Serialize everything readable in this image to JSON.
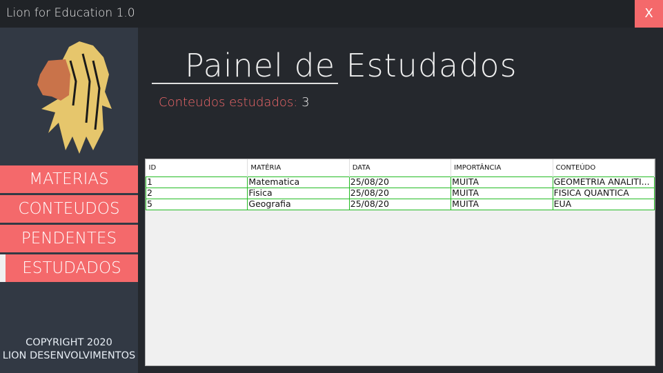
{
  "window": {
    "title": "Lion for Education 1.0",
    "close_label": "X"
  },
  "sidebar": {
    "items": [
      {
        "label": "MATERIAS"
      },
      {
        "label": "CONTEUDOS"
      },
      {
        "label": "PENDENTES"
      },
      {
        "label": "ESTUDADOS",
        "active": true
      }
    ],
    "copyright": [
      "COPYRIGHT 2020",
      "LION DESENVOLVIMENTOS"
    ]
  },
  "colors": {
    "accent": "#f4696b",
    "sidebar": "#323944",
    "background": "#25282d",
    "logo_mane": "#e6c66c",
    "logo_face": "#c9734a"
  },
  "main": {
    "title": "Painel de Estudados",
    "count_label": "Conteudos estudados:",
    "count_value": "3"
  },
  "table": {
    "columns": [
      "ID",
      "MATÉRIA",
      "DATA",
      "IMPORTÂNCIA",
      "CONTEÚDO"
    ],
    "rows": [
      [
        "1",
        "Matematica",
        "25/08/20",
        "MUITA",
        "GEOMETRIA ANALITI..."
      ],
      [
        "2",
        "Fisica",
        "25/08/20",
        "MUITA",
        "FISICA QUANTICA"
      ],
      [
        "5",
        "Geografia",
        "25/08/20",
        "MUITA",
        "EUA"
      ]
    ]
  }
}
